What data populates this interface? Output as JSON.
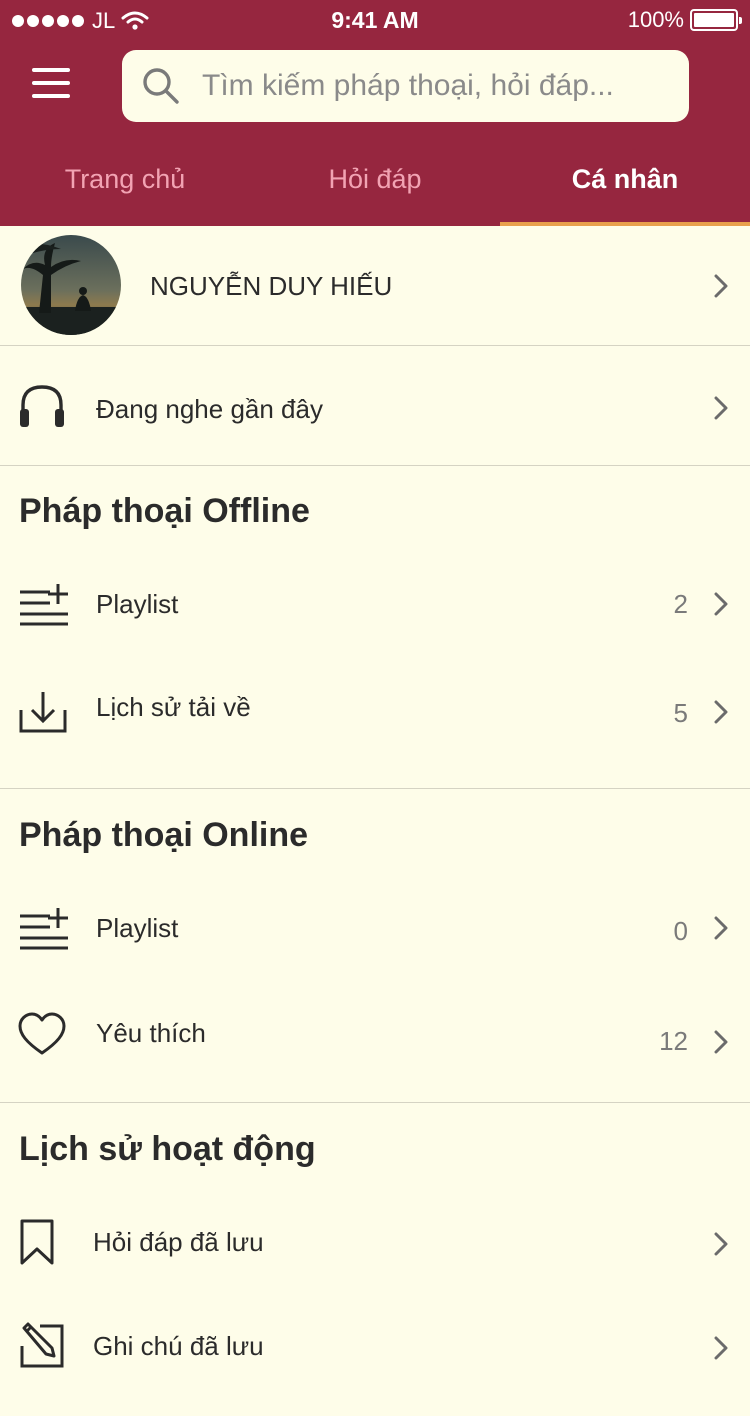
{
  "status_bar": {
    "carrier": "JL",
    "time": "9:41 AM",
    "battery": "100%"
  },
  "search": {
    "placeholder": "Tìm kiếm pháp thoại, hỏi đáp..."
  },
  "tabs": [
    {
      "label": "Trang chủ"
    },
    {
      "label": "Hỏi đáp"
    },
    {
      "label": "Cá nhân"
    }
  ],
  "profile": {
    "name": "NGUYỄN DUY HIẾU"
  },
  "recent": {
    "label": "Đang nghe gần đây"
  },
  "offline": {
    "title": "Pháp thoại Offline",
    "playlist": {
      "label": "Playlist",
      "count": "2"
    },
    "downloads": {
      "label": "Lịch sử tải về",
      "count": "5"
    }
  },
  "online": {
    "title": "Pháp thoại Online",
    "playlist": {
      "label": "Playlist",
      "count": "0"
    },
    "favorites": {
      "label": "Yêu thích",
      "count": "12"
    }
  },
  "activity": {
    "title": "Lịch sử hoạt động",
    "saved_qa": {
      "label": "Hỏi đáp đã lưu"
    },
    "saved_notes": {
      "label": "Ghi chú đã lưu"
    }
  },
  "colors": {
    "header": "#96263f",
    "background": "#fefde9",
    "tab_indicator": "#e8a04c"
  },
  "icons": [
    "search-icon",
    "menu-icon",
    "headphones-icon",
    "playlist-add-icon",
    "download-icon",
    "heart-icon",
    "bookmark-icon",
    "edit-note-icon",
    "chevron-right-icon",
    "wifi-icon",
    "battery-icon"
  ]
}
